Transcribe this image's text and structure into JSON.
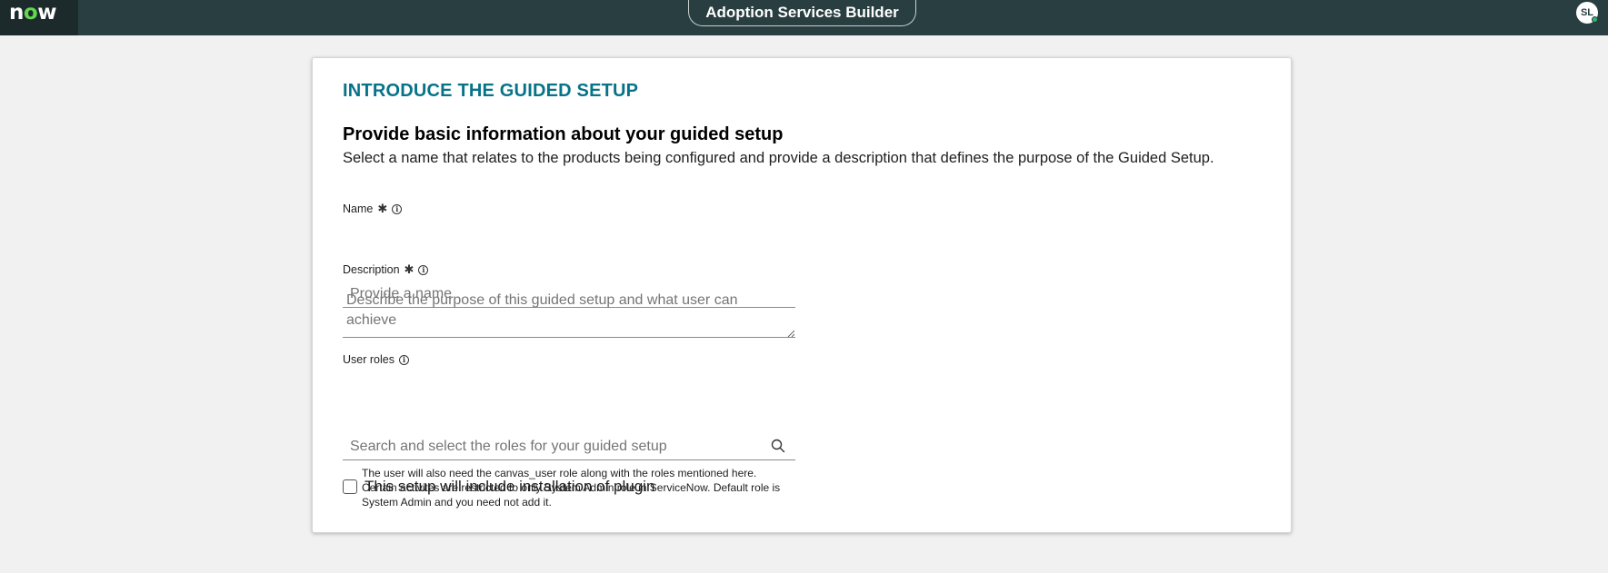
{
  "app": {
    "logo_text_n": "n",
    "logo_text_o": "o",
    "logo_text_w": "w",
    "title": "Adoption Services Builder",
    "user_initials": "SL"
  },
  "form": {
    "section_title": "INTRODUCE THE GUIDED SETUP",
    "heading": "Provide basic information about your guided setup",
    "subheading": "Select a name that relates to the products being configured and provide a description that defines the purpose of the Guided Setup.",
    "name": {
      "label": "Name",
      "required_mark": "✱",
      "value": "",
      "placeholder": "Provide a name"
    },
    "description": {
      "label": "Description",
      "required_mark": "✱",
      "value": "",
      "placeholder": "Describe the purpose of this guided setup and what user can achieve"
    },
    "user_roles": {
      "label": "User roles",
      "value": "",
      "placeholder": "Search and select the roles for your guided setup",
      "hint": "The user will also need the canvas_user role along with the roles mentioned here. Certain activites are restricted to only System Admin role in ServiceNow. Default role is System Admin and you need not add it."
    },
    "plugin_checkbox": {
      "label": "This setup will include installation of plugin",
      "checked": false
    }
  },
  "colors": {
    "topbar": "#293e40",
    "logo_bg": "#1c2a2c",
    "logo_accent": "#62d84e",
    "section_title": "#067389",
    "page_bg": "#f1f1f1"
  }
}
